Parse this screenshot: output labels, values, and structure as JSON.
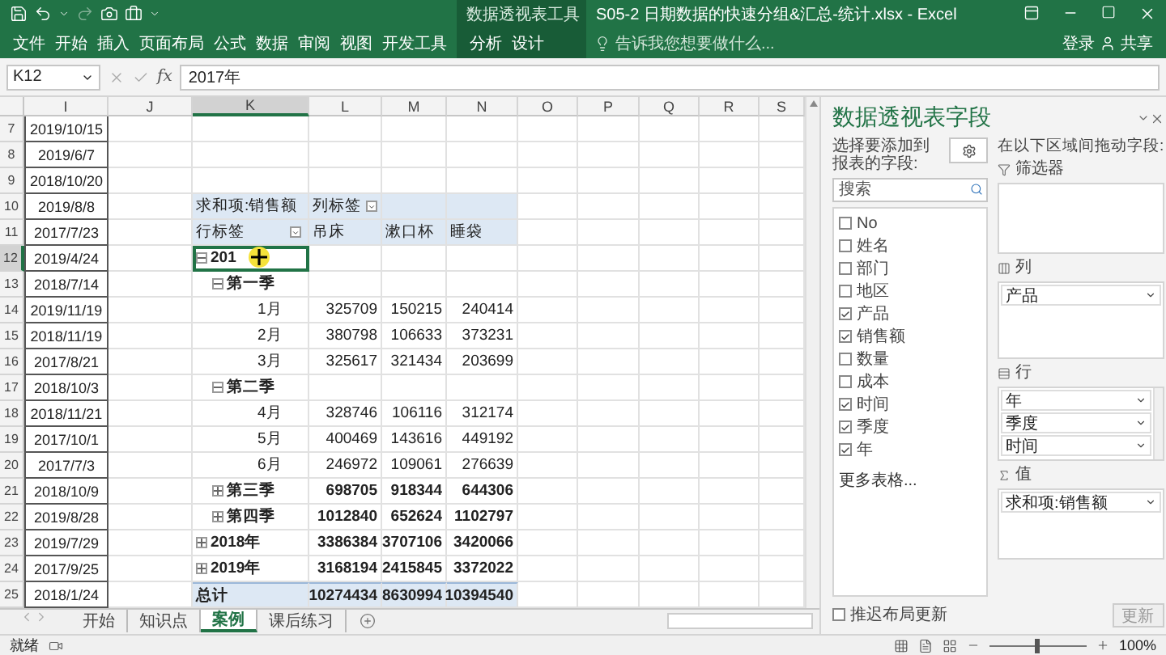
{
  "title_bar": {
    "title": "S05-2 日期数据的快速分组&汇总-统计.xlsx - Excel",
    "context_label": "数据透视表工具"
  },
  "ribbon": {
    "tabs": [
      "文件",
      "开始",
      "插入",
      "页面布局",
      "公式",
      "数据",
      "审阅",
      "视图",
      "开发工具"
    ],
    "context_tabs": [
      "分析",
      "设计"
    ],
    "tell_me": "告诉我您想要做什么...",
    "sign_in": "登录",
    "share": "共享"
  },
  "formula_bar": {
    "name_box": "K12",
    "function_label": "fx",
    "value": "2017年"
  },
  "sheet": {
    "columns": [
      {
        "label": "I",
        "selected": false
      },
      {
        "label": "J",
        "selected": false
      },
      {
        "label": "K",
        "selected": true
      },
      {
        "label": "L",
        "selected": false
      },
      {
        "label": "M",
        "selected": false
      },
      {
        "label": "N",
        "selected": false
      },
      {
        "label": "O",
        "selected": false
      },
      {
        "label": "P",
        "selected": false
      },
      {
        "label": "Q",
        "selected": false
      },
      {
        "label": "R",
        "selected": false
      },
      {
        "label": "S",
        "selected": false
      }
    ],
    "rows": [
      {
        "number": "7",
        "selected": false,
        "date": "2019/10/15"
      },
      {
        "number": "8",
        "selected": false,
        "date": "2019/6/7"
      },
      {
        "number": "9",
        "selected": false,
        "date": "2018/10/20"
      },
      {
        "number": "10",
        "selected": false,
        "date": "2019/8/8"
      },
      {
        "number": "11",
        "selected": false,
        "date": "2017/7/23"
      },
      {
        "number": "12",
        "selected": true,
        "date": "2019/4/24"
      },
      {
        "number": "13",
        "selected": false,
        "date": "2018/7/14"
      },
      {
        "number": "14",
        "selected": false,
        "date": "2019/11/19"
      },
      {
        "number": "15",
        "selected": false,
        "date": "2018/11/19"
      },
      {
        "number": "16",
        "selected": false,
        "date": "2017/8/21"
      },
      {
        "number": "17",
        "selected": false,
        "date": "2018/10/3"
      },
      {
        "number": "18",
        "selected": false,
        "date": "2018/11/21"
      },
      {
        "number": "19",
        "selected": false,
        "date": "2017/10/1"
      },
      {
        "number": "20",
        "selected": false,
        "date": "2017/7/3"
      },
      {
        "number": "21",
        "selected": false,
        "date": "2018/10/9"
      },
      {
        "number": "22",
        "selected": false,
        "date": "2019/8/28"
      },
      {
        "number": "23",
        "selected": false,
        "date": "2019/7/29"
      },
      {
        "number": "24",
        "selected": false,
        "date": "2017/9/25"
      },
      {
        "number": "25",
        "selected": false,
        "date": "2018/1/24"
      }
    ]
  },
  "pivot": {
    "value_label": "求和项:销售额",
    "column_label": "列标签",
    "row_label": "行标签",
    "products": [
      "吊床",
      "漱口杯",
      "睡袋"
    ],
    "rows": [
      {
        "label": "201",
        "expanded": true,
        "selected": true,
        "children": [
          {
            "label": "第一季",
            "expanded": true,
            "selected": false,
            "children": [
              {
                "label": "1月",
                "selected": false,
                "values": [
                  "325709",
                  "150215",
                  "240414"
                ]
              },
              {
                "label": "2月",
                "selected": false,
                "values": [
                  "380798",
                  "106633",
                  "373231"
                ]
              },
              {
                "label": "3月",
                "selected": false,
                "values": [
                  "325617",
                  "321434",
                  "203699"
                ]
              }
            ]
          },
          {
            "label": "第二季",
            "expanded": true,
            "selected": false,
            "children": [
              {
                "label": "4月",
                "selected": false,
                "values": [
                  "328746",
                  "106116",
                  "312174"
                ]
              },
              {
                "label": "5月",
                "selected": false,
                "values": [
                  "400469",
                  "143616",
                  "449192"
                ]
              },
              {
                "label": "6月",
                "selected": false,
                "values": [
                  "246972",
                  "109061",
                  "276639"
                ]
              }
            ]
          },
          {
            "label": "第三季",
            "expanded": false,
            "selected": false,
            "values": [
              "698705",
              "918344",
              "644306"
            ]
          },
          {
            "label": "第四季",
            "expanded": false,
            "selected": false,
            "values": [
              "1012840",
              "652624",
              "1102797"
            ]
          }
        ]
      },
      {
        "label": "2018年",
        "expanded": false,
        "selected": false,
        "values": [
          "3386384",
          "3707106",
          "3420066"
        ]
      },
      {
        "label": "2019年",
        "expanded": false,
        "selected": false,
        "values": [
          "3168194",
          "2415845",
          "3372022"
        ]
      }
    ],
    "total": {
      "label": "总计",
      "values": [
        "10274434",
        "8630994",
        "10394540"
      ]
    }
  },
  "sheet_tabs": [
    {
      "label": "开始",
      "selected": false
    },
    {
      "label": "知识点",
      "selected": false
    },
    {
      "label": "案例",
      "selected": true
    },
    {
      "label": "课后练习",
      "selected": false
    }
  ],
  "status_bar": {
    "status": "就绪",
    "zoom": {
      "label": "100%",
      "level": 0.5
    }
  },
  "field_panel": {
    "title": "数据透视表字段",
    "choose_label": "选择要添加到报表的字段:",
    "search_placeholder": "搜索",
    "fields": [
      {
        "name": "No",
        "checked": false
      },
      {
        "name": "姓名",
        "checked": false
      },
      {
        "name": "部门",
        "checked": false
      },
      {
        "name": "地区",
        "checked": false
      },
      {
        "name": "产品",
        "checked": true
      },
      {
        "name": "销售额",
        "checked": true
      },
      {
        "name": "数量",
        "checked": false
      },
      {
        "name": "成本",
        "checked": false
      },
      {
        "name": "时间",
        "checked": true
      },
      {
        "name": "季度",
        "checked": true
      },
      {
        "name": "年",
        "checked": true
      }
    ],
    "more_tables": "更多表格...",
    "drag_label": "在以下区域间拖动字段:",
    "areas": [
      {
        "kind": "filter",
        "title": "筛选器"
      },
      {
        "kind": "columns",
        "title": "列",
        "items": [
          "产品"
        ]
      },
      {
        "kind": "rows",
        "title": "行",
        "items": [
          "年",
          "季度",
          "时间"
        ]
      },
      {
        "kind": "values",
        "title": "值",
        "items": [
          "求和项:销售额"
        ]
      }
    ],
    "defer_label": "推迟布局更新",
    "defer_checked": false,
    "update_button": "更新"
  }
}
